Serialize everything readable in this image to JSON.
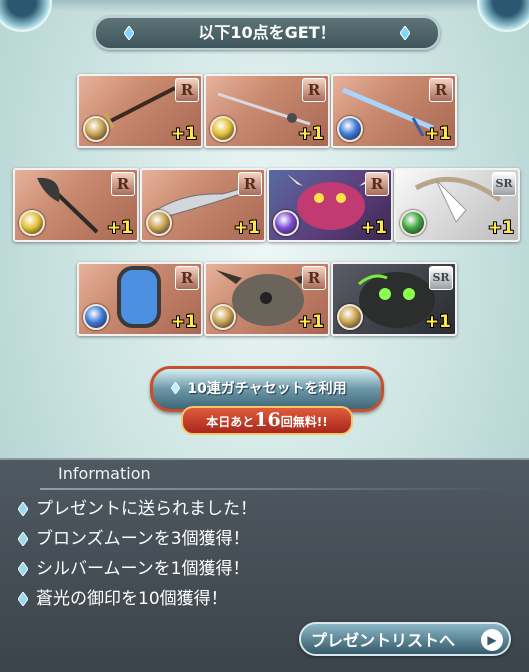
{
  "header": {
    "banner_text": "以下10点をGET！"
  },
  "rows": [
    [
      {
        "rarity": "R",
        "element": "light",
        "element_color": "#c9a24f",
        "plus": "+1",
        "art": "sword"
      },
      {
        "rarity": "R",
        "element": "light-gold",
        "element_color": "#e3c034",
        "plus": "+1",
        "art": "rapier"
      },
      {
        "rarity": "R",
        "element": "water",
        "element_color": "#3f79d8",
        "plus": "+1",
        "art": "ice-sword"
      }
    ],
    [
      {
        "rarity": "R",
        "element": "light-gold",
        "element_color": "#e3c034",
        "plus": "+1",
        "art": "axe"
      },
      {
        "rarity": "R",
        "element": "light",
        "element_color": "#c9a24f",
        "plus": "+1",
        "art": "blade"
      },
      {
        "rarity": "R",
        "element": "dark",
        "element_color": "#7b4ad1",
        "plus": "+1",
        "art": "demon"
      },
      {
        "rarity": "SR",
        "element": "wind",
        "element_color": "#3ea53e",
        "plus": "+1",
        "art": "bow"
      }
    ],
    [
      {
        "rarity": "R",
        "element": "water",
        "element_color": "#3f79d8",
        "plus": "+1",
        "art": "mirror"
      },
      {
        "rarity": "R",
        "element": "light",
        "element_color": "#c9a24f",
        "plus": "+1",
        "art": "beast"
      },
      {
        "rarity": "SR",
        "element": "light",
        "element_color": "#c9a24f",
        "plus": "+1",
        "art": "golem"
      }
    ]
  ],
  "gacha": {
    "button_label": "10連ガチャセットを利用",
    "free_prefix": "本日あと",
    "free_count": "16",
    "free_suffix": "回無料!!"
  },
  "info": {
    "title": "Information",
    "lines": [
      "プレゼントに送られました！",
      "ブロンズムーンを3個獲得！",
      "シルバームーンを1個獲得！",
      "蒼光の御印を10個獲得！"
    ]
  },
  "present_button": {
    "label": "プレゼントリストへ",
    "icon": "arrow-right-icon"
  }
}
